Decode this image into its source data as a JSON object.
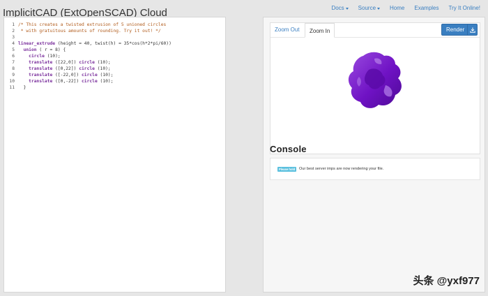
{
  "header": {
    "app_title": "ImplicitCAD (ExtOpenSCAD) Cloud",
    "nav": [
      {
        "label": "Docs",
        "dropdown": true
      },
      {
        "label": "Source",
        "dropdown": true
      },
      {
        "label": "Home",
        "dropdown": false
      },
      {
        "label": "Examples",
        "dropdown": false
      },
      {
        "label": "Try It Online!",
        "dropdown": false
      }
    ]
  },
  "editor": {
    "lines": [
      {
        "n": "1",
        "tokens": [
          {
            "t": "cm",
            "v": "/* This creates a twisted extrusion of 5 unioned circles"
          }
        ]
      },
      {
        "n": "2",
        "tokens": [
          {
            "t": "cm",
            "v": " * with gratuitous amounts of rounding. Try it out! */"
          }
        ]
      },
      {
        "n": "3",
        "tokens": []
      },
      {
        "n": "4",
        "tokens": [
          {
            "t": "kw",
            "v": "linear_extrude"
          },
          {
            "t": "pl",
            "v": " (height = 40, twist(h) = 35*cos(h*2*pi/60))"
          }
        ]
      },
      {
        "n": "5",
        "tokens": [
          {
            "t": "pl",
            "v": "  "
          },
          {
            "t": "kw",
            "v": "union"
          },
          {
            "t": "pl",
            "v": " ( r = 8) {"
          }
        ]
      },
      {
        "n": "6",
        "tokens": [
          {
            "t": "pl",
            "v": "    "
          },
          {
            "t": "kw",
            "v": "circle"
          },
          {
            "t": "pl",
            "v": " (10);"
          }
        ]
      },
      {
        "n": "7",
        "tokens": [
          {
            "t": "pl",
            "v": "    "
          },
          {
            "t": "kw",
            "v": "translate"
          },
          {
            "t": "pl",
            "v": " ([22,0]) "
          },
          {
            "t": "kw",
            "v": "circle"
          },
          {
            "t": "pl",
            "v": " (10);"
          }
        ]
      },
      {
        "n": "8",
        "tokens": [
          {
            "t": "pl",
            "v": "    "
          },
          {
            "t": "kw",
            "v": "translate"
          },
          {
            "t": "pl",
            "v": " ([0,22]) "
          },
          {
            "t": "kw",
            "v": "circle"
          },
          {
            "t": "pl",
            "v": " (10);"
          }
        ]
      },
      {
        "n": "9",
        "tokens": [
          {
            "t": "pl",
            "v": "    "
          },
          {
            "t": "kw",
            "v": "translate"
          },
          {
            "t": "pl",
            "v": " ([-22,0]) "
          },
          {
            "t": "kw",
            "v": "circle"
          },
          {
            "t": "pl",
            "v": " (10);"
          }
        ]
      },
      {
        "n": "10",
        "tokens": [
          {
            "t": "pl",
            "v": "    "
          },
          {
            "t": "kw",
            "v": "translate"
          },
          {
            "t": "pl",
            "v": " ([0,-22]) "
          },
          {
            "t": "kw",
            "v": "circle"
          },
          {
            "t": "pl",
            "v": " (10);"
          }
        ]
      },
      {
        "n": "11",
        "tokens": [
          {
            "t": "pl",
            "v": "  }"
          }
        ]
      }
    ]
  },
  "viewer": {
    "zoom_out_label": "Zoom Out",
    "zoom_in_label": "Zoom In",
    "render_label": "Render",
    "model_color": "#7a18c9"
  },
  "console": {
    "title": "Console",
    "badge": "Please hold",
    "message": "Our best server imps are now rendering your file."
  },
  "watermark": "头条 @yxf977",
  "colors": {
    "accent": "#3a7fc1",
    "badge": "#5bc0de",
    "comment": "#b05a1a",
    "keyword": "#7a2f9c"
  }
}
